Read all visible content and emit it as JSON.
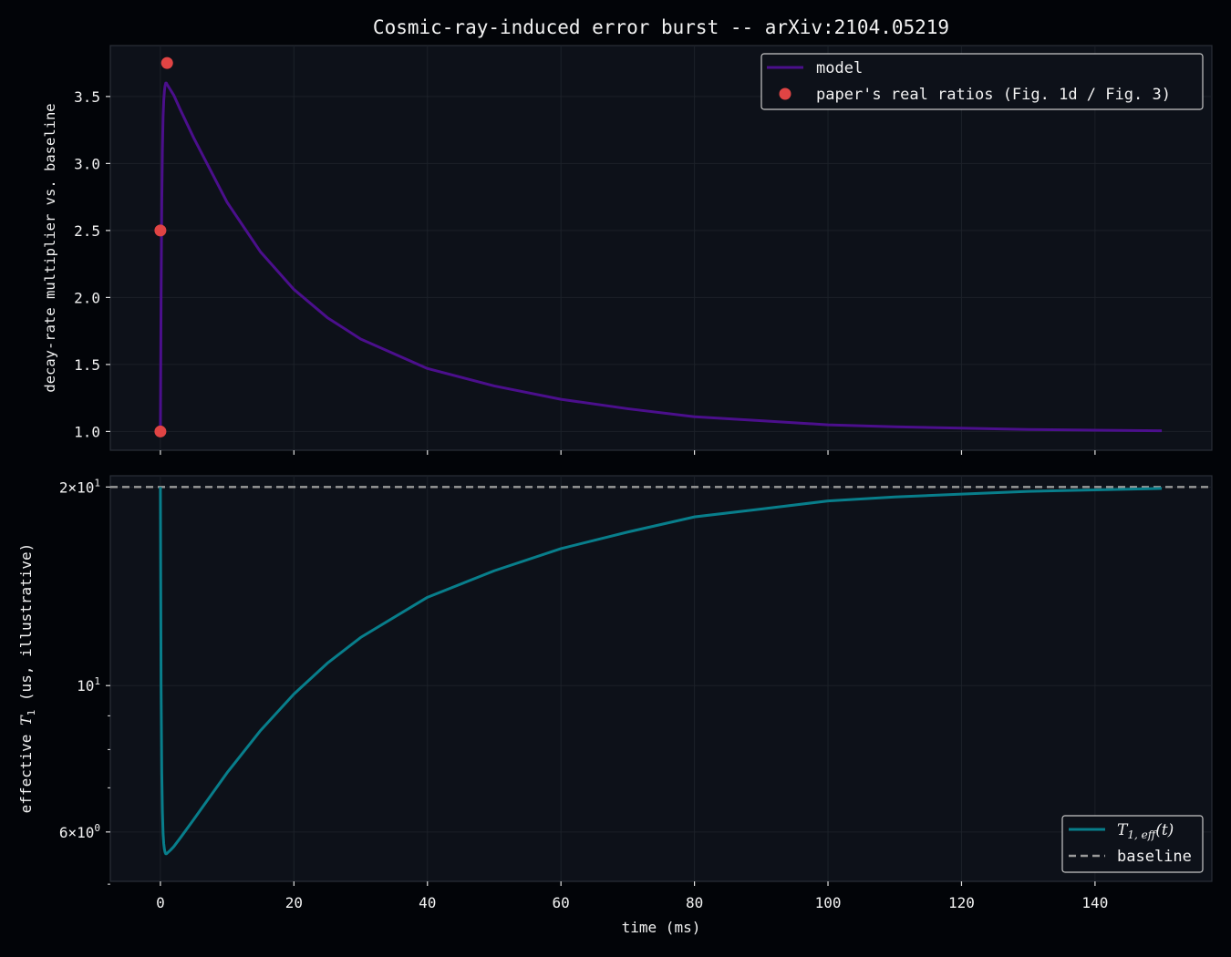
{
  "chart_data": {
    "title": "Cosmic-ray-induced error burst -- arXiv:2104.05219",
    "xlabel": "time (ms)",
    "xlim": [
      -7.5,
      157.5
    ],
    "xticks": [
      "0",
      "20",
      "40",
      "60",
      "80",
      "100",
      "120",
      "140"
    ],
    "grid": true,
    "colors": {
      "figure_bg": "#020408",
      "axes_bg": "#0d1119",
      "model": "#4b0f8c",
      "paper_points": "#e04444",
      "t1": "#087e8b",
      "baseline": "#9a9a9a"
    },
    "panels": [
      {
        "type": "line",
        "ylabel": "decay-rate multiplier vs. baseline",
        "ylim": [
          0.86,
          3.88
        ],
        "yticks": [
          "1.0",
          "1.5",
          "2.0",
          "2.5",
          "3.0",
          "3.5"
        ],
        "legend_position": "top-right",
        "legend": [
          {
            "label": "model",
            "kind": "line"
          },
          {
            "label": "paper's real ratios (Fig. 1d / Fig. 3)",
            "kind": "marker"
          }
        ],
        "series": [
          {
            "name": "model",
            "x": [
              0,
              0.1,
              0.2,
              0.3,
              0.4,
              0.5,
              0.6,
              0.7,
              0.8,
              0.9,
              1.0,
              1.5,
              2,
              3,
              5,
              10,
              15,
              20,
              25,
              30,
              40,
              50,
              60,
              70,
              80,
              90,
              100,
              110,
              120,
              130,
              140,
              150
            ],
            "y": [
              1.0,
              2.0,
              2.7,
              3.1,
              3.35,
              3.47,
              3.54,
              3.58,
              3.6,
              3.6,
              3.59,
              3.55,
              3.51,
              3.4,
              3.19,
              2.71,
              2.34,
              2.06,
              1.85,
              1.69,
              1.47,
              1.34,
              1.24,
              1.17,
              1.11,
              1.08,
              1.05,
              1.035,
              1.025,
              1.015,
              1.01,
              1.005
            ]
          },
          {
            "name": "paper's real ratios (Fig. 1d / Fig. 3)",
            "type": "scatter",
            "x": [
              0,
              0,
              1
            ],
            "y": [
              1.0,
              2.5,
              3.75
            ]
          }
        ]
      },
      {
        "type": "line",
        "ylabel": "effective T1 (us, illustrative)",
        "yscale": "log",
        "ylim": [
          5.05,
          20.8
        ],
        "yticks": [
          {
            "value": 20,
            "mantissa": "2",
            "exponent": "1"
          },
          {
            "value": 10,
            "mantissa": "",
            "exponent": "1"
          },
          {
            "value": 6,
            "mantissa": "6",
            "exponent": "0"
          }
        ],
        "minor_yticks": [
          5,
          7,
          8,
          9
        ],
        "legend_position": "bottom-right",
        "legend": [
          {
            "label": "T1,eff(t)",
            "kind": "line"
          },
          {
            "label": "baseline",
            "kind": "dashed"
          }
        ],
        "series": [
          {
            "name": "T1,eff(t)",
            "x": [
              0,
              0.1,
              0.2,
              0.3,
              0.4,
              0.5,
              0.6,
              0.7,
              0.8,
              0.9,
              1.0,
              1.5,
              2,
              3,
              5,
              10,
              15,
              20,
              25,
              30,
              40,
              50,
              60,
              70,
              80,
              90,
              100,
              110,
              120,
              130,
              140,
              150
            ],
            "y": [
              20.0,
              10.0,
              7.4,
              6.45,
              5.97,
              5.76,
              5.65,
              5.59,
              5.56,
              5.56,
              5.57,
              5.63,
              5.7,
              5.88,
              6.27,
              7.38,
              8.55,
              9.71,
              10.81,
              11.83,
              13.61,
              14.93,
              16.13,
              17.09,
              18.02,
              18.52,
              19.05,
              19.32,
              19.51,
              19.7,
              19.8,
              19.9
            ]
          },
          {
            "name": "baseline",
            "type": "hline",
            "y": 20
          }
        ]
      }
    ]
  }
}
